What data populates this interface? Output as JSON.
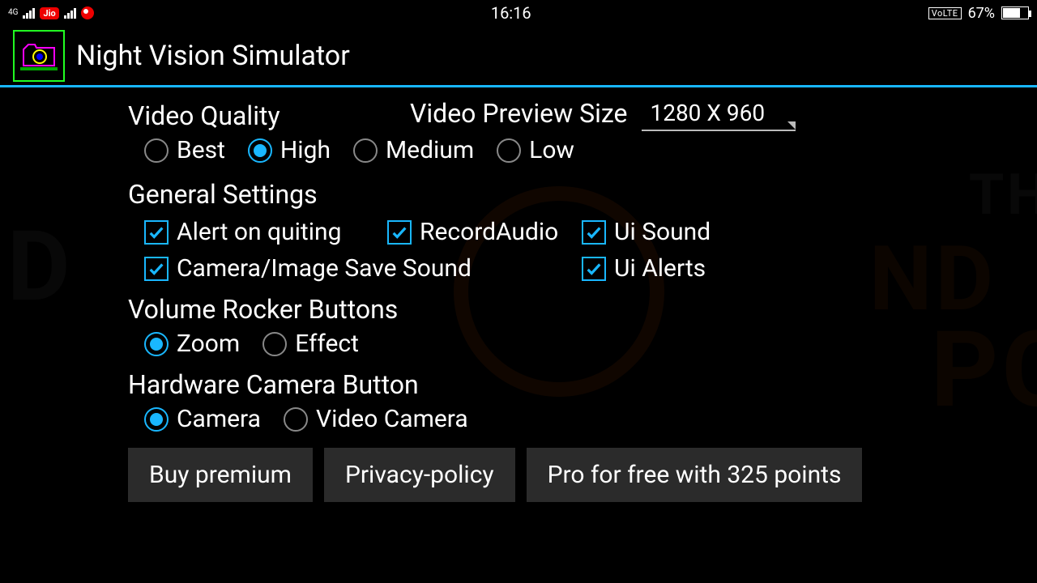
{
  "status": {
    "net": "4G",
    "carrier1": "Jio",
    "time": "16:16",
    "volte": "VoLTE",
    "battery_pct": "67%"
  },
  "app": {
    "title": "Night Vision Simulator"
  },
  "video_quality": {
    "heading": "Video Quality",
    "options": {
      "best": "Best",
      "high": "High",
      "medium": "Medium",
      "low": "Low"
    },
    "selected": "high"
  },
  "preview_size": {
    "label": "Video Preview Size",
    "value": "1280 X 960"
  },
  "general": {
    "heading": "General Settings",
    "alert_quit": "Alert on quiting",
    "record_audio": "RecordAudio",
    "ui_sound": "Ui Sound",
    "cam_save_sound": "Camera/Image Save  Sound",
    "ui_alerts": "Ui Alerts"
  },
  "volume_rocker": {
    "heading": "Volume Rocker Buttons",
    "options": {
      "zoom": "Zoom",
      "effect": "Effect"
    },
    "selected": "zoom"
  },
  "hw_cam": {
    "heading": "Hardware Camera Button",
    "options": {
      "camera": "Camera",
      "video_camera": "Video Camera"
    },
    "selected": "camera"
  },
  "buttons": {
    "buy": "Buy premium",
    "privacy": "Privacy-policy",
    "pro": "Pro for free with 325 points"
  }
}
